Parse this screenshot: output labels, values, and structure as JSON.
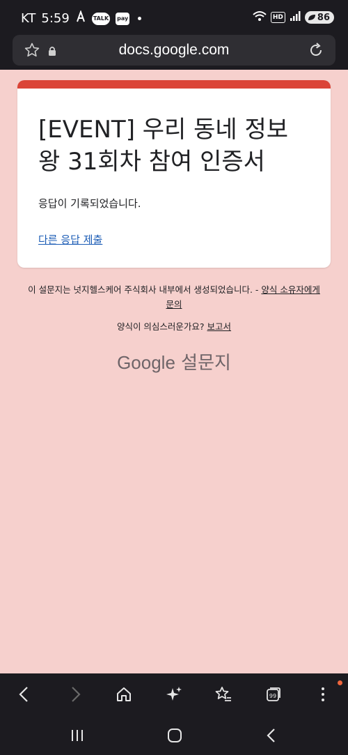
{
  "status_bar": {
    "carrier": "KT",
    "time": "5:59",
    "talk_label": "TALK",
    "pay_label": "pay",
    "hd_label": "HD",
    "battery_level": "86"
  },
  "browser": {
    "url": "docs.google.com"
  },
  "form": {
    "title": "[EVENT] 우리 동네 정보왕 31회차 참여 인증서",
    "message": "응답이 기록되었습니다.",
    "link": "다른 응답 제출",
    "accent_color": "#db4437"
  },
  "footer": {
    "created_by": "이 설문지는 넛지헬스케어 주식회사 내부에서 생성되었습니다. - ",
    "contact_link": "양식 소유자에게 문의",
    "suspicious": "양식이 의심스러운가요? ",
    "report_link": "보고서",
    "brand_google": "Google",
    "brand_forms": "설문지"
  },
  "icons": {
    "back": "chevron-left-icon",
    "forward": "chevron-right-icon",
    "home": "home-icon",
    "ai": "sparkle-icon",
    "bookmarks": "star-list-icon",
    "tabs": "tabs-icon",
    "menu": "more-vert-icon"
  }
}
